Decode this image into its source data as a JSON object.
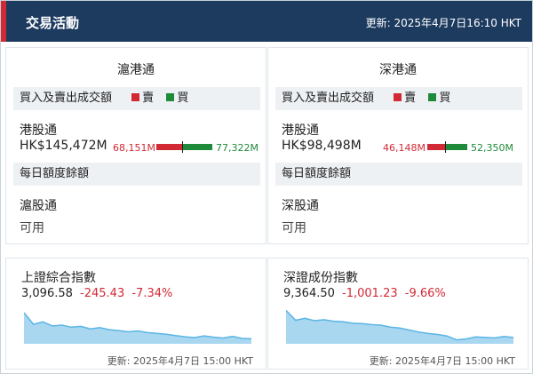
{
  "header": {
    "title": "交易活動",
    "updated": "更新: 2025年4月7日16:10 HKT"
  },
  "turnover_label": "買入及賣出成交額",
  "legend": {
    "sell": "賣",
    "buy": "買"
  },
  "quota_label": "每日額度餘額",
  "quota_value": "可用",
  "colors": {
    "header_bg": "#1d3a5f",
    "accent": "#d12a35",
    "buy": "#1f8a3a",
    "sell": "#d12a35",
    "spark_fill": "#a9d7f0",
    "spark_line": "#5ab5e4"
  },
  "left": {
    "title": "滬港通",
    "connect_name": "港股通",
    "total": "HK$145,472M",
    "sell": "68,151M",
    "buy": "77,322M",
    "sell_share": 0.4685,
    "quota_name": "滬股通"
  },
  "right": {
    "title": "深港通",
    "connect_name": "港股通",
    "total": "HK$98,498M",
    "sell": "46,148M",
    "buy": "52,350M",
    "sell_share": 0.4685,
    "quota_name": "深股通"
  },
  "indices": [
    {
      "name": "上證綜合指數",
      "value": "3,096.58",
      "change": "-245.43",
      "pct": "-7.34%",
      "updated": "更新: 2025年4月7日 15:00 HKT",
      "chart_data": {
        "type": "area",
        "values": [
          3160,
          3132,
          3138,
          3128,
          3130,
          3125,
          3127,
          3121,
          3124,
          3119,
          3117,
          3114,
          3116,
          3112,
          3110,
          3108,
          3105,
          3102,
          3100,
          3104,
          3101,
          3099,
          3103,
          3098,
          3097
        ],
        "ylim": [
          3085,
          3175
        ]
      }
    },
    {
      "name": "深證成份指數",
      "value": "9,364.50",
      "change": "-1,001.23",
      "pct": "-9.66%",
      "updated": "更新: 2025年4月7日 15:00 HKT",
      "chart_data": {
        "type": "area",
        "values": [
          9640,
          9540,
          9560,
          9535,
          9545,
          9530,
          9525,
          9510,
          9505,
          9495,
          9490,
          9470,
          9460,
          9440,
          9420,
          9405,
          9395,
          9380,
          9340,
          9350,
          9370,
          9365,
          9360,
          9375,
          9364
        ],
        "ylim": [
          9300,
          9680
        ]
      }
    }
  ]
}
